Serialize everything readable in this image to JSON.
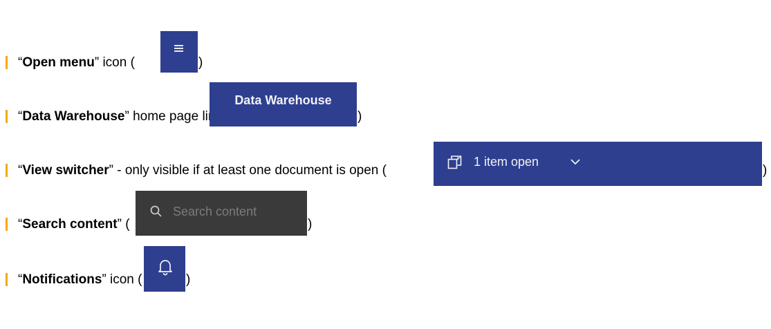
{
  "items": [
    {
      "name": "Open menu",
      "suffix": " icon (",
      "close": ")",
      "thumbnail_icon": "hamburger-menu-icon"
    },
    {
      "name": "Data Warehouse",
      "suffix": " home page link (",
      "close": ")",
      "thumbnail_label": "Data Warehouse"
    },
    {
      "name": "View switcher",
      "suffix": " - only visible if at least one document is open (",
      "close": ")",
      "thumbnail_icon": "view-switcher-icon",
      "thumbnail_label": "1 item open",
      "thumbnail_chevron": "chevron-down-icon"
    },
    {
      "name": "Search content",
      "suffix": " (",
      "close": ")",
      "thumbnail_icon": "search-icon",
      "thumbnail_placeholder": "Search content"
    },
    {
      "name": "Notifications",
      "suffix": " icon (",
      "close": ")",
      "thumbnail_icon": "bell-icon"
    }
  ],
  "colors": {
    "bullet": "#f2a900",
    "thumb_blue": "#2f3f8f",
    "thumb_dark": "#3a3a3a"
  },
  "quote_open": "“",
  "quote_close": "”"
}
